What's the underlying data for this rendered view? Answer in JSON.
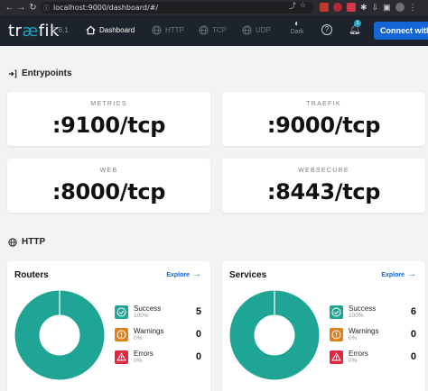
{
  "browser": {
    "url": "localhost:9000/dashboard/#/"
  },
  "header": {
    "logo_text": "træfik",
    "version": "2.6.1",
    "nav": [
      {
        "label": "Dashboard",
        "icon": "home-icon",
        "active": true
      },
      {
        "label": "HTTP",
        "icon": "globe-icon",
        "active": false
      },
      {
        "label": "TCP",
        "icon": "globe-icon",
        "active": false
      },
      {
        "label": "UDP",
        "icon": "globe-icon",
        "active": false
      }
    ],
    "dark_label": "Dark",
    "notifications_count": "1",
    "connect_label": "Connect with"
  },
  "entrypoints": {
    "title": "Entrypoints",
    "items": [
      {
        "name": "METRICS",
        "address": ":9100/tcp"
      },
      {
        "name": "TRAEFIK",
        "address": ":9000/tcp"
      },
      {
        "name": "WEB",
        "address": ":8000/tcp"
      },
      {
        "name": "WEBSECURE",
        "address": ":8443/tcp"
      }
    ]
  },
  "http": {
    "title": "HTTP",
    "routers": {
      "title": "Routers",
      "explore_label": "Explore",
      "stats": [
        {
          "label": "Success",
          "percent": "100%",
          "count": "5",
          "color": "#1fa595"
        },
        {
          "label": "Warnings",
          "percent": "0%",
          "count": "0",
          "color": "#e1801a"
        },
        {
          "label": "Errors",
          "percent": "0%",
          "count": "0",
          "color": "#e5243d"
        }
      ]
    },
    "services": {
      "title": "Services",
      "explore_label": "Explore",
      "stats": [
        {
          "label": "Success",
          "percent": "100%",
          "count": "6",
          "color": "#1fa595"
        },
        {
          "label": "Warnings",
          "percent": "0%",
          "count": "0",
          "color": "#e1801a"
        },
        {
          "label": "Errors",
          "percent": "0%",
          "count": "0",
          "color": "#e5243d"
        }
      ]
    }
  },
  "colors": {
    "header_bg": "#1d232c",
    "accent": "#1465d8",
    "success": "#1fa595",
    "warning": "#e1801a",
    "error": "#e5243d"
  }
}
